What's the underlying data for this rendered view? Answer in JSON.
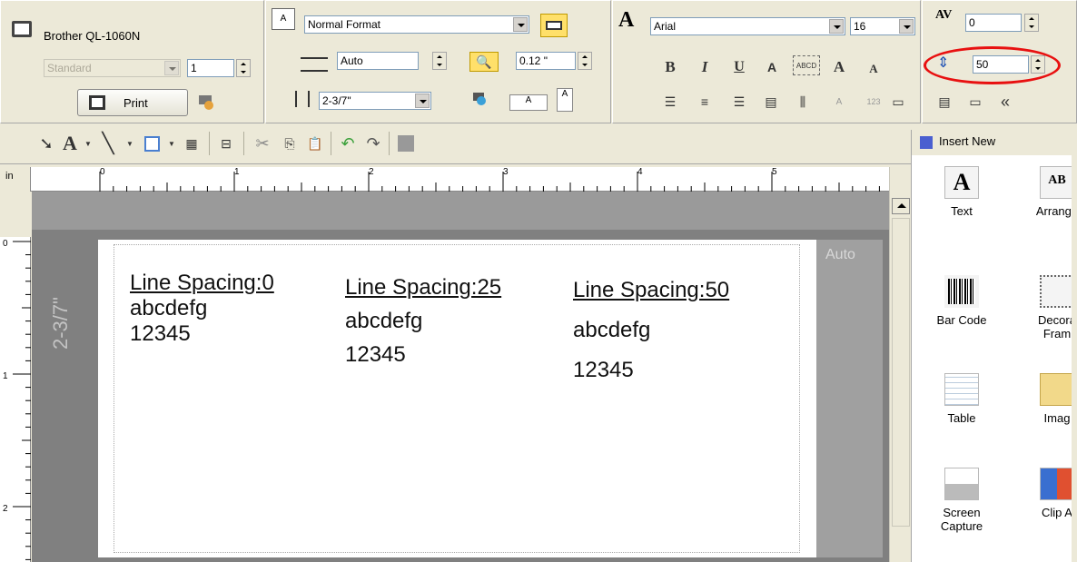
{
  "printer": {
    "name": "Brother QL-1060N",
    "mode": "Standard",
    "copies": "1",
    "print_label": "Print"
  },
  "format": {
    "style": "Normal Format",
    "length_mode": "Auto",
    "margin": "0.12 \"",
    "tape_width": "2-3/7\""
  },
  "font": {
    "family": "Arial",
    "size": "16",
    "char_spacing": "0",
    "line_spacing": "50"
  },
  "ruler": {
    "unit": "in",
    "h_numbers": [
      "0",
      "1",
      "2",
      "3",
      "4",
      "5"
    ],
    "v_numbers": [
      "0",
      "1",
      "2"
    ]
  },
  "label": {
    "auto_text": "Auto",
    "length_text": "2-3/7\"",
    "columns": [
      {
        "heading": "Line Spacing:0",
        "line1": "abcdefg",
        "line2": "12345"
      },
      {
        "heading": "Line Spacing:25",
        "line1": "abcdefg",
        "line2": "12345"
      },
      {
        "heading": "Line Spacing:50",
        "line1": "abcdefg",
        "line2": "12345"
      }
    ]
  },
  "insert_panel": {
    "title": "Insert New",
    "items": [
      {
        "label": "Text",
        "label2": ""
      },
      {
        "label": "Arrange",
        "label2": ""
      },
      {
        "label": "Bar Code",
        "label2": ""
      },
      {
        "label": "Decora",
        "label2": "Fram"
      },
      {
        "label": "Table",
        "label2": ""
      },
      {
        "label": "Imag",
        "label2": ""
      },
      {
        "label": "Screen",
        "label2": "Capture"
      },
      {
        "label": "Clip A",
        "label2": ""
      }
    ]
  },
  "colors": {
    "highlight_ring": "#e81010",
    "toolbar_bg": "#ECE9D8",
    "canvas_bg": "#808080"
  }
}
